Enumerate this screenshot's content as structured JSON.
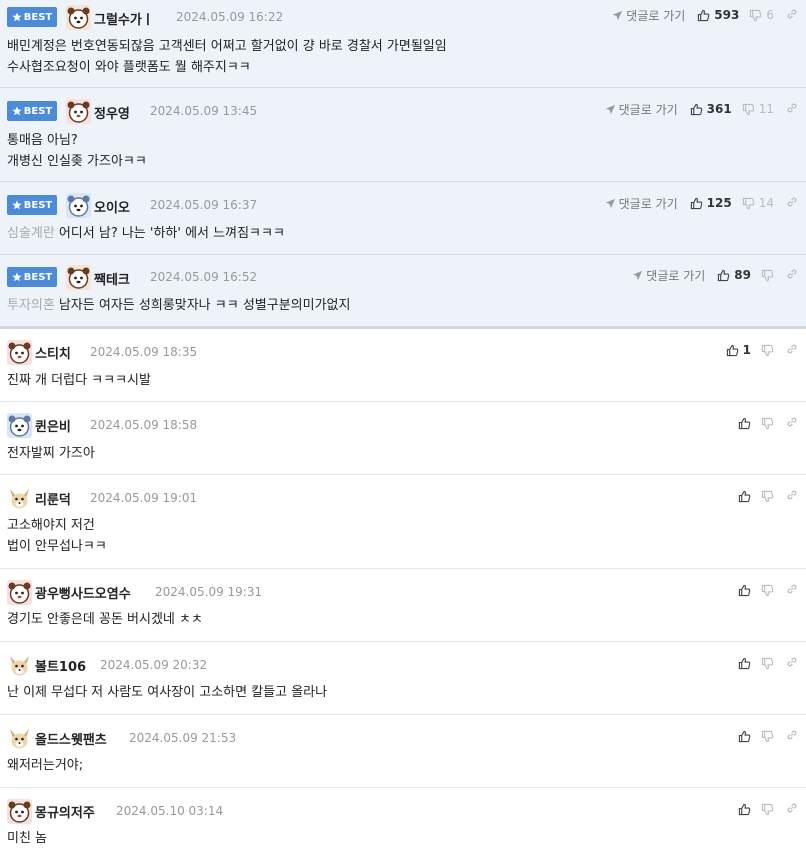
{
  "best_label": "BEST",
  "reply_label": "댓글로 가기",
  "comments": [
    {
      "nick": "그럴수가ㅣ",
      "date": "2024.05.09 16:22",
      "likes": "593",
      "dislikes": "6",
      "lines": [
        "배민계정은 번호연동되잖음 고객센터 어쩌고 할거없이 걍 바로 경찰서 가면될일임",
        "수사협조요청이 와야 플랫폼도 뭘 해주지ㅋㅋ"
      ],
      "tag": ""
    },
    {
      "nick": "정우영",
      "date": "2024.05.09 13:45",
      "likes": "361",
      "dislikes": "11",
      "lines": [
        "통매음 아님?",
        "개병신 인실좆 가즈아ㅋㅋ"
      ],
      "tag": ""
    },
    {
      "nick": "오이오",
      "date": "2024.05.09 16:37",
      "likes": "125",
      "dislikes": "14",
      "lines": [
        "어디서 남? 나는 '하하' 에서 느껴짐ㅋㅋㅋ"
      ],
      "tag": "심술계란"
    },
    {
      "nick": "짹테크",
      "date": "2024.05.09 16:52",
      "likes": "89",
      "dislikes": "",
      "lines": [
        "남자든 여자든 성희롱맞자나 ㅋㅋ 성별구분의미가없지"
      ],
      "tag": "투자의혼"
    },
    {
      "nick": "스티치",
      "date": "2024.05.09 18:35",
      "likes": "1",
      "dislikes": "",
      "lines": [
        "진짜 개 더럽다 ㅋㅋㅋ시발"
      ],
      "tag": ""
    },
    {
      "nick": "퀸은비",
      "date": "2024.05.09 18:58",
      "likes": "",
      "dislikes": "",
      "lines": [
        "전자발찌 가즈아"
      ],
      "tag": ""
    },
    {
      "nick": "리룬덕",
      "date": "2024.05.09 19:01",
      "likes": "",
      "dislikes": "",
      "lines": [
        "고소해야지 저건",
        "법이 안무섭나ㅋㅋ"
      ],
      "tag": ""
    },
    {
      "nick": "광우뻥사드오염수",
      "date": "2024.05.09 19:31",
      "likes": "",
      "dislikes": "",
      "lines": [
        "경기도 안좋은데 꽁돈 버시겠네 ㅊㅊ"
      ],
      "tag": ""
    },
    {
      "nick": "볼트106",
      "date": "2024.05.09 20:32",
      "likes": "",
      "dislikes": "",
      "lines": [
        "난 이제 무섭다 저 사람도 여사장이 고소하면 칼들고 올라나"
      ],
      "tag": ""
    },
    {
      "nick": "올드스웻팬츠",
      "date": "2024.05.09 21:53",
      "likes": "",
      "dislikes": "",
      "lines": [
        "왜저러는거야;"
      ],
      "tag": ""
    },
    {
      "nick": "몽규의저주",
      "date": "2024.05.10 03:14",
      "likes": "",
      "dislikes": "",
      "lines": [
        "미친 놈"
      ],
      "tag": ""
    }
  ]
}
